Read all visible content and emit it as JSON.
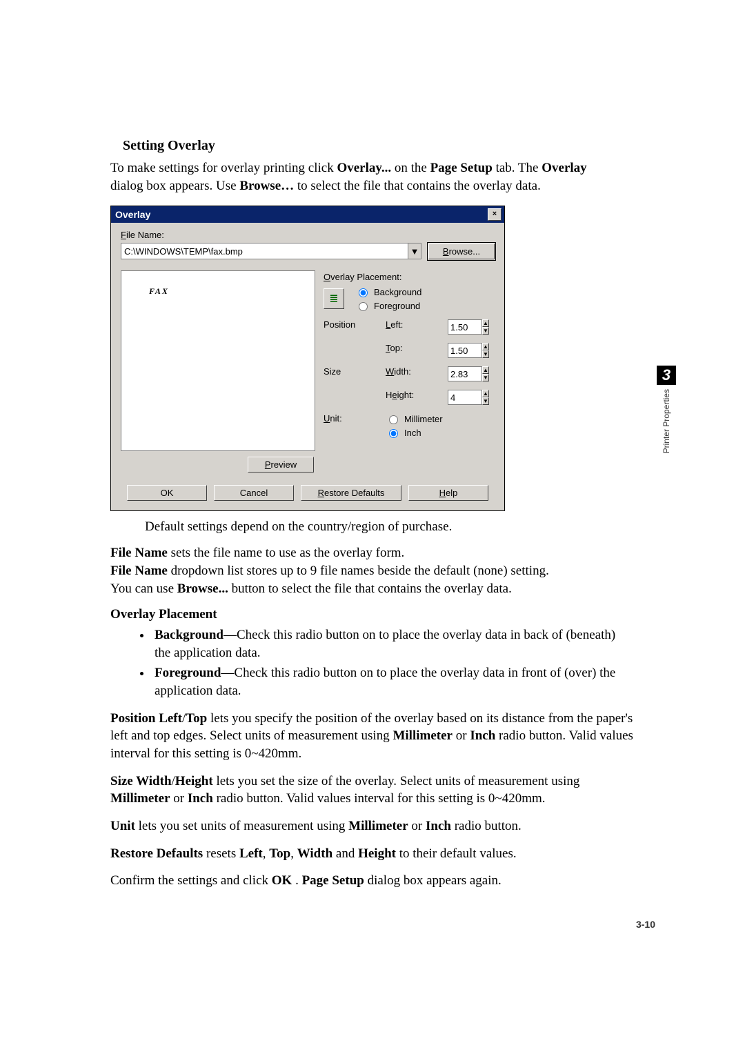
{
  "heading": "Setting Overlay",
  "intro": {
    "pre": "To make settings for overlay printing click ",
    "b1": "Overlay...",
    "mid1": " on the ",
    "b2": "Page Setup",
    "mid2": " tab. The ",
    "b3": "Overlay",
    "line2_pre": "dialog box appears. Use ",
    "b4": "Browse…",
    "line2_post": " to select the file that contains the overlay data."
  },
  "dialog": {
    "title": "Overlay",
    "close": "×",
    "file_name_label": "File Name:",
    "file_name_value": "C:\\WINDOWS\\TEMP\\fax.bmp",
    "browse": "Browse...",
    "preview_text": "FAX",
    "preview_button": "Preview",
    "placement_label": "Overlay Placement:",
    "placement_icon": "≣",
    "radio_background": "Background",
    "radio_foreground": "Foreground",
    "position_label": "Position",
    "left_label": "Left:",
    "left_value": "1.50",
    "top_label": "Top:",
    "top_value": "1.50",
    "size_label": "Size",
    "width_label": "Width:",
    "width_value": "2.83",
    "height_label": "Height:",
    "height_value": "4",
    "unit_label": "Unit:",
    "radio_mm": "Millimeter",
    "radio_inch": "Inch",
    "ok": "OK",
    "cancel": "Cancel",
    "restore": "Restore Defaults",
    "help": "Help"
  },
  "note": "Default settings depend on the country/region of purchase.",
  "para1": {
    "b1": "File Name",
    "t1": " sets the file name to use as the overlay form."
  },
  "para2": {
    "b1": "File Name",
    "t1": " dropdown list stores up to 9 file names beside the default (none) setting."
  },
  "para3": {
    "t1": "You can use ",
    "b1": "Browse...",
    "t2": " button to select the file that contains the overlay data."
  },
  "subhead_placement": "Overlay Placement",
  "bullet_bg": {
    "b": "Background",
    "t": "—Check this radio button on to place the overlay data in back of (beneath) the application data."
  },
  "bullet_fg": {
    "b": "Foreground",
    "t": "—Check this radio button on to place the overlay data in front of (over) the application data."
  },
  "para_pos": {
    "b1": "Position Left",
    "sep1": "/",
    "b2": "Top",
    "t1": " lets you specify the position of the overlay based on its distance from the paper's left and top edges. Select units of measurement using ",
    "b3": "Millimeter",
    "t2": " or ",
    "b4": "Inch",
    "t3": " radio button. Valid values interval for this setting is 0~420mm."
  },
  "para_size": {
    "b1": "Size Width",
    "sep1": "/",
    "b2": "Height",
    "t1": " lets you set the size of the overlay. Select units of measurement using ",
    "b3": "Millimeter",
    "t2": " or ",
    "b4": "Inch",
    "t3": " radio button. Valid values interval for this setting is 0~420mm."
  },
  "para_unit": {
    "b1": "Unit",
    "t1": " lets you set units of measurement using ",
    "b2": "Millimeter",
    "t2": " or ",
    "b3": "Inch",
    "t3": " radio button."
  },
  "para_restore": {
    "b1": "Restore Defaults",
    "t1": " resets ",
    "b2": "Left",
    "c1": ", ",
    "b3": "Top",
    "c2": ", ",
    "b4": "Width",
    "t2": " and ",
    "b5": "Height",
    "t3": " to their default values."
  },
  "para_confirm": {
    "t1": "Confirm the settings and click ",
    "b1": "OK",
    "t2": ". ",
    "b2": "Page Setup",
    "t3": " dialog box appears again."
  },
  "side": {
    "chapter": "3",
    "label": "Printer Properties"
  },
  "page_number": "3-10"
}
